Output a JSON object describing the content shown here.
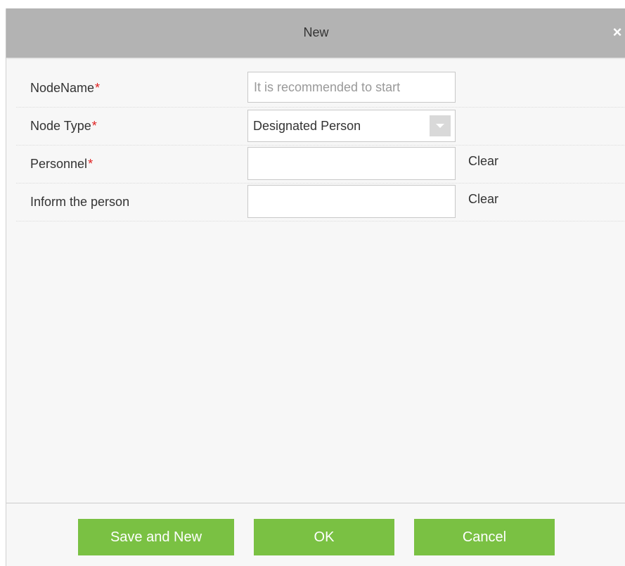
{
  "dialog": {
    "title": "New",
    "close_icon": "×"
  },
  "form": {
    "node_name": {
      "label": "NodeName",
      "required_mark": "*",
      "value": "",
      "placeholder": "It is recommended to start"
    },
    "node_type": {
      "label": "Node Type",
      "required_mark": "*",
      "selected": "Designated Person"
    },
    "personnel": {
      "label": "Personnel",
      "required_mark": "*",
      "value": "",
      "clear_label": "Clear"
    },
    "inform": {
      "label": "Inform the person",
      "value": "",
      "clear_label": "Clear"
    }
  },
  "footer": {
    "save_new_label": "Save and New",
    "ok_label": "OK",
    "cancel_label": "Cancel"
  },
  "colors": {
    "button_green": "#7ac143",
    "titlebar_gray": "#b3b3b3",
    "required_red": "#e02020"
  }
}
